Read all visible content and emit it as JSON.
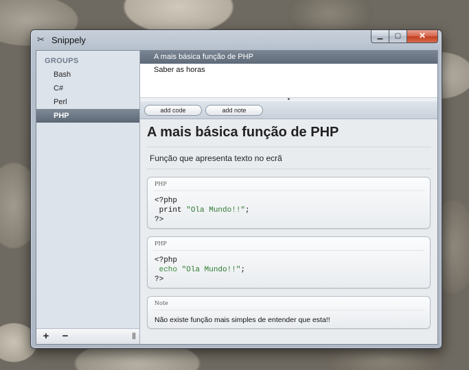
{
  "window": {
    "title": "Snippely",
    "app_icon": "scissors-icon",
    "controls": {
      "minimize": "minimize-icon",
      "maximize": "maximize-icon",
      "close": "close-icon"
    }
  },
  "sidebar": {
    "header": "GROUPS",
    "items": [
      {
        "label": "Bash",
        "selected": false
      },
      {
        "label": "C#",
        "selected": false
      },
      {
        "label": "Perl",
        "selected": false
      },
      {
        "label": "PHP",
        "selected": true
      }
    ],
    "bottom": {
      "add": "+",
      "remove": "−",
      "grip": "|||"
    }
  },
  "snippets": [
    {
      "label": "A mais básica função de PHP",
      "selected": true
    },
    {
      "label": "Saber as horas",
      "selected": false
    }
  ],
  "toolbar": {
    "add_code": "add code",
    "add_note": "add note"
  },
  "content": {
    "title": "A mais básica função de PHP",
    "description": "Função que apresenta texto no ecrã",
    "blocks": [
      {
        "type": "code",
        "label": "PHP",
        "lines": [
          {
            "code": "<?php",
            "string": "",
            "end": ""
          },
          {
            "code": " print ",
            "string": "\"Ola Mundo!!\"",
            "end": ";"
          },
          {
            "code": "?>",
            "string": "",
            "end": ""
          }
        ]
      },
      {
        "type": "code",
        "label": "PHP",
        "lines": [
          {
            "code": "<?php",
            "string": "",
            "end": ""
          },
          {
            "code": " echo ",
            "string": "\"Ola Mundo!!\"",
            "end": ";"
          },
          {
            "code": "?>",
            "string": "",
            "end": ""
          }
        ]
      },
      {
        "type": "note",
        "label": "Note",
        "text": "Não existe função mais simples de entender que esta!!"
      }
    ]
  },
  "colors": {
    "selection": "#5f6a79",
    "string": "#2f7a2f",
    "sidebar_bg": "#dde3eb"
  }
}
